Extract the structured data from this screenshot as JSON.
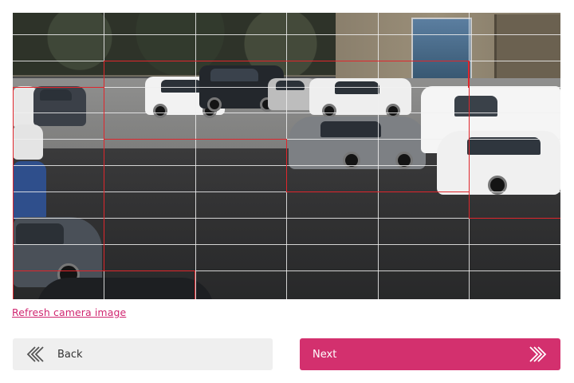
{
  "camera": {
    "alt": "camera image of a car park",
    "grid": {
      "columns": 6,
      "rows": 11
    }
  },
  "refresh_link": {
    "label": "Refresh camera image"
  },
  "buttons": {
    "back": {
      "label": "Back",
      "icon": "double-chevron-left-icon"
    },
    "next": {
      "label": "Next",
      "icon": "double-chevron-right-icon"
    }
  },
  "colors": {
    "accent": "#d3306e",
    "selection": "#e0262c",
    "back_button_bg": "#efefef"
  }
}
